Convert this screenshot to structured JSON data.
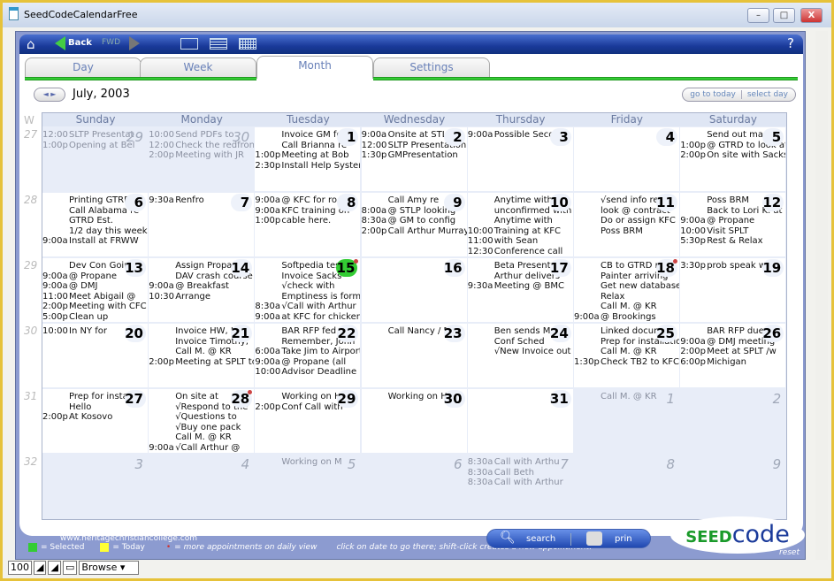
{
  "window": {
    "title": "SeedCodeCalendarFree",
    "minimize": "–",
    "maximize": "□",
    "close": "X"
  },
  "toolbar": {
    "home_icon": "home-icon",
    "back": "Back",
    "fwd": "FWD",
    "help": "?"
  },
  "tabs": [
    {
      "label": "Day"
    },
    {
      "label": "Week"
    },
    {
      "label": "Month",
      "active": true
    },
    {
      "label": "Settings"
    }
  ],
  "nav": {
    "arrows": "◄ ►",
    "month_label": "July, 2003",
    "go_to_today": "go to today",
    "select_day": "select day"
  },
  "week_header": "W",
  "weekdays": [
    "Sunday",
    "Monday",
    "Tuesday",
    "Wednesday",
    "Thursday",
    "Friday",
    "Saturday"
  ],
  "week_numbers": [
    "27",
    "28",
    "29",
    "30",
    "31",
    "32"
  ],
  "weeks": [
    [
      {
        "n": "29",
        "o": true,
        "e": [
          [
            "12:00",
            "SLTP Presentat"
          ],
          [
            "1:00p",
            "Opening at Bel"
          ]
        ]
      },
      {
        "n": "30",
        "o": true,
        "e": [
          [
            "10:00",
            "Send PDFs to"
          ],
          [
            "12:00",
            "Check the redfront"
          ],
          [
            "2:00p",
            "Meeting with JR"
          ]
        ]
      },
      {
        "n": "1",
        "e": [
          [
            "",
            "Invoice GM fc"
          ],
          [
            "",
            "Call Brianna re"
          ],
          [
            "1:00p",
            "Meeting at Bob"
          ],
          [
            "2:30p",
            "Install Help System"
          ]
        ]
      },
      {
        "n": "2",
        "e": [
          [
            "9:00a",
            "Onsite at STLP"
          ],
          [
            "12:00",
            "SLTP Presentation"
          ],
          [
            "1:30p",
            "GMPresentation"
          ]
        ]
      },
      {
        "n": "3",
        "e": [
          [
            "9:00a",
            "Possible Secon"
          ]
        ]
      },
      {
        "n": "4",
        "e": []
      },
      {
        "n": "5",
        "e": [
          [
            "",
            "Send out man"
          ],
          [
            "1:00p",
            "@ GTRD to look at"
          ],
          [
            "2:00p",
            "On site with Sacks"
          ]
        ]
      }
    ],
    [
      {
        "n": "6",
        "e": [
          [
            "",
            "Printing GTRD"
          ],
          [
            "",
            "Call Alabama re"
          ],
          [
            "",
            "GTRD Est."
          ],
          [
            "",
            "1/2 day this week"
          ],
          [
            "9:00a",
            "Install at FRWW"
          ]
        ]
      },
      {
        "n": "7",
        "e": [
          [
            "9:30a",
            "Renfro"
          ]
        ]
      },
      {
        "n": "8",
        "e": [
          [
            "9:00a",
            "@ KFC for ro"
          ],
          [
            "9:00a",
            "KFC training on"
          ],
          [
            "1:00p",
            "cable here."
          ]
        ]
      },
      {
        "n": "9",
        "e": [
          [
            "",
            "Call Amy re"
          ],
          [
            "8:00a",
            "@ STLP looking"
          ],
          [
            "8:30a",
            "@ GM to config"
          ],
          [
            "2:00p",
            "Call Arthur Murray"
          ]
        ]
      },
      {
        "n": "10",
        "e": [
          [
            "",
            "Anytime with"
          ],
          [
            "",
            "unconfirmed with"
          ],
          [
            "",
            "Anytime with"
          ],
          [
            "10:00",
            "Training at KFC"
          ],
          [
            "11:00",
            "with Sean"
          ],
          [
            "12:30",
            "Conference call"
          ]
        ]
      },
      {
        "n": "11",
        "e": [
          [
            "",
            "√send info re"
          ],
          [
            "",
            "look @ contract"
          ],
          [
            "",
            "Do or assign KFC"
          ],
          [
            "",
            "Poss BRM"
          ]
        ]
      },
      {
        "n": "12",
        "e": [
          [
            "",
            "Poss BRM"
          ],
          [
            "",
            "Back to Lori K. at"
          ],
          [
            "9:00a",
            "@ Propane"
          ],
          [
            "10:00",
            "Visit SPLT"
          ],
          [
            "5:30p",
            "Rest & Relax"
          ]
        ]
      }
    ],
    [
      {
        "n": "13",
        "e": [
          [
            "",
            "Dev Con Goin"
          ],
          [
            "9:00a",
            "@ Propane"
          ],
          [
            "9:00a",
            "@ DMJ"
          ],
          [
            "11:00",
            "Meet Abigail @"
          ],
          [
            "2:00p",
            "Meeting with CFC"
          ],
          [
            "5:00p",
            "Clean up"
          ]
        ]
      },
      {
        "n": "14",
        "e": [
          [
            "",
            "Assign Propar"
          ],
          [
            "",
            "DAV crash course"
          ],
          [
            "9:00a",
            "@ Breakfast"
          ],
          [
            "10:30",
            "Arrange"
          ]
        ]
      },
      {
        "n": "15",
        "sel": true,
        "more": true,
        "e": [
          [
            "",
            "Softpedia test"
          ],
          [
            "",
            "Invoice Sacks"
          ],
          [
            "",
            "√check with"
          ],
          [
            "",
            "Emptiness is form"
          ],
          [
            "8:30a",
            "√Call with Arthur"
          ],
          [
            "9:00a",
            "at KFC for chicken"
          ]
        ]
      },
      {
        "n": "16",
        "e": []
      },
      {
        "n": "17",
        "e": [
          [
            "",
            "Beta Presental"
          ],
          [
            "",
            "Arthur delivers"
          ],
          [
            "9:30a",
            "Meeting @ BMC"
          ]
        ]
      },
      {
        "n": "18",
        "more": true,
        "e": [
          [
            "",
            "CB to GTRD re"
          ],
          [
            "",
            "Painter arriving"
          ],
          [
            "",
            "Get new database"
          ],
          [
            "",
            "Relax"
          ],
          [
            "",
            "Call M. @ KR"
          ],
          [
            "9:00a",
            "@ Brookings"
          ]
        ]
      },
      {
        "n": "19",
        "e": [
          [
            "3:30p",
            "prob speak w."
          ]
        ]
      }
    ],
    [
      {
        "n": "20",
        "e": [
          [
            "10:00",
            "In NY for"
          ]
        ]
      },
      {
        "n": "21",
        "e": [
          [
            "",
            "Invoice HW, I"
          ],
          [
            "",
            "Invoice Timothy,"
          ],
          [
            "",
            "Call M. @ KR"
          ],
          [
            "2:00p",
            "Meeting at SPLT to"
          ]
        ]
      },
      {
        "n": "22",
        "e": [
          [
            "",
            "BAR RFP fed e"
          ],
          [
            "",
            "Remember, John"
          ],
          [
            "6:00a",
            "Take Jim to Airport"
          ],
          [
            "9:00a",
            "@ Propane (all"
          ],
          [
            "10:00",
            "Advisor Deadline"
          ]
        ]
      },
      {
        "n": "23",
        "e": [
          [
            "",
            "Call Nancy / D"
          ]
        ]
      },
      {
        "n": "24",
        "e": [
          [
            "",
            "Ben sends Ma"
          ],
          [
            "",
            "Conf Sched"
          ],
          [
            "",
            "√New Invoice out"
          ]
        ]
      },
      {
        "n": "25",
        "e": [
          [
            "",
            "Linked docum"
          ],
          [
            "",
            "Prep for installation"
          ],
          [
            "",
            "Call M. @ KR"
          ],
          [
            "1:30p",
            "Check TB2 to KFC"
          ]
        ]
      },
      {
        "n": "26",
        "e": [
          [
            "",
            "BAR RFP due"
          ],
          [
            "9:00a",
            "@ DMJ meeting"
          ],
          [
            "2:00p",
            "Meet at SPLT /w"
          ],
          [
            "6:00p",
            "Michigan"
          ]
        ]
      }
    ],
    [
      {
        "n": "27",
        "e": [
          [
            "",
            "Prep for install"
          ],
          [
            "",
            "Hello"
          ],
          [
            "2:00p",
            "At Kosovo"
          ]
        ]
      },
      {
        "n": "28",
        "more": true,
        "e": [
          [
            "",
            "On site at"
          ],
          [
            "",
            "√Respond to the"
          ],
          [
            "",
            "√Questions to"
          ],
          [
            "",
            "√Buy one pack"
          ],
          [
            "",
            "Call M. @ KR"
          ],
          [
            "9:00a",
            "√Call Arthur @"
          ]
        ]
      },
      {
        "n": "29",
        "e": [
          [
            "",
            "Working on H"
          ],
          [
            "2:00p",
            "Conf Call with"
          ]
        ]
      },
      {
        "n": "30",
        "e": [
          [
            "",
            "Working on H"
          ]
        ]
      },
      {
        "n": "31",
        "e": []
      },
      {
        "n": "1",
        "o": true,
        "e": [
          [
            "",
            "Call M. @ KR"
          ]
        ]
      },
      {
        "n": "2",
        "o": true,
        "e": []
      }
    ],
    [
      {
        "n": "3",
        "o": true,
        "e": []
      },
      {
        "n": "4",
        "o": true,
        "e": []
      },
      {
        "n": "5",
        "o": true,
        "e": [
          [
            "",
            "Working on M"
          ]
        ]
      },
      {
        "n": "6",
        "o": true,
        "e": []
      },
      {
        "n": "7",
        "o": true,
        "e": [
          [
            "8:30a",
            "Call with Arthu"
          ],
          [
            "8:30a",
            "Call Beth"
          ],
          [
            "8:30a",
            "Call with Arthur"
          ]
        ]
      },
      {
        "n": "8",
        "o": true,
        "e": []
      },
      {
        "n": "9",
        "o": true,
        "e": []
      }
    ]
  ],
  "footer": {
    "url": "www.heritagechristiancollege.com",
    "selected": "= Selected",
    "today": "= Today",
    "more": "= more appointments on daily view",
    "hint": "click on date to go there; shift-click creates a new appointment.",
    "search": "search",
    "print": "prin",
    "reset": "reset",
    "logo_seed": "SEED",
    "logo_code": "code"
  },
  "status": {
    "zoom": "100",
    "mode": "Browse"
  },
  "colors": {
    "selected": "#33cc33",
    "today": "#ffff33",
    "toolbar": "#1a3a9a",
    "logo_green": "#1a9a2a",
    "logo_blue": "#1a3a9a"
  }
}
